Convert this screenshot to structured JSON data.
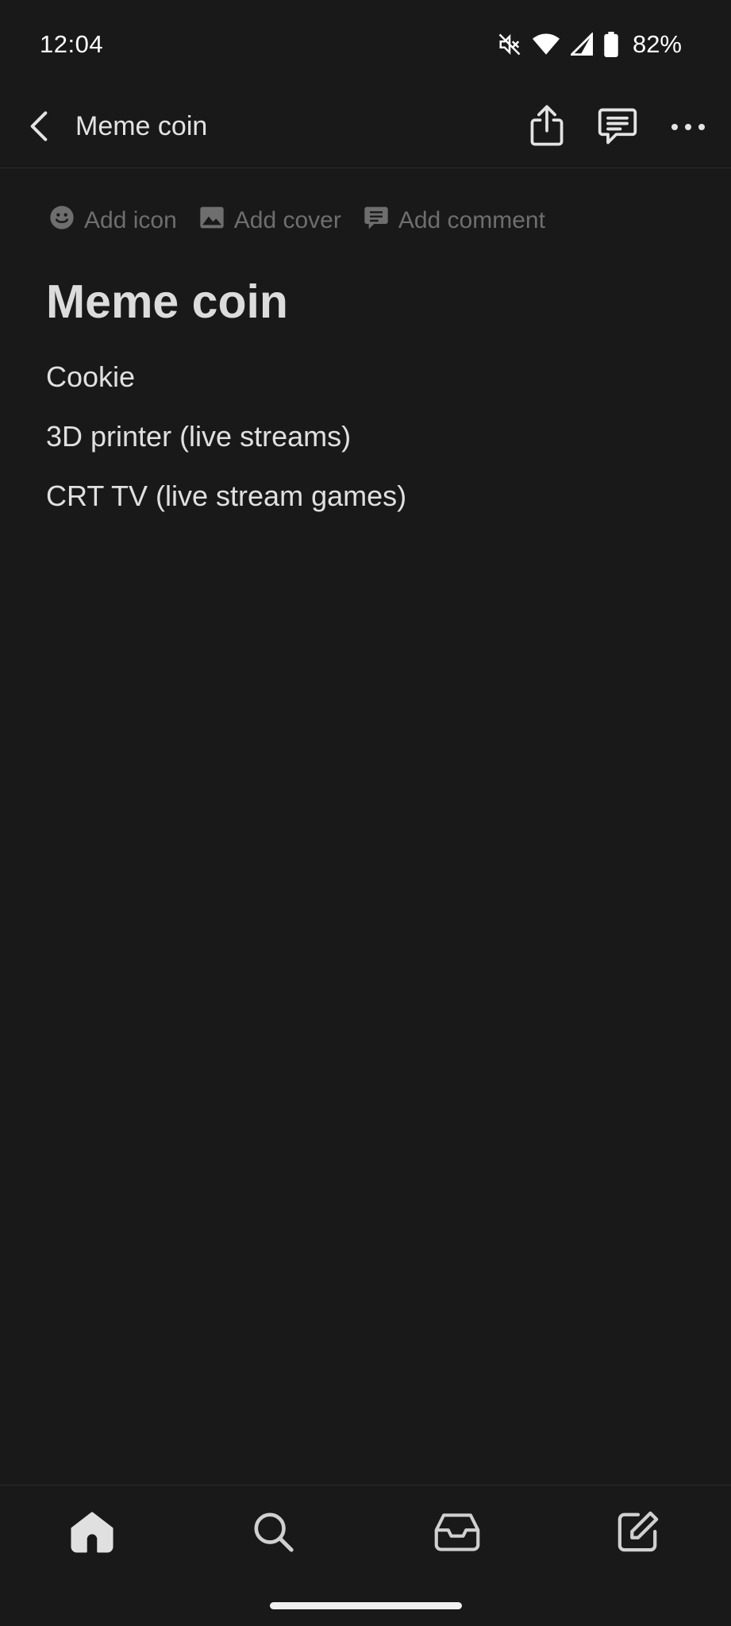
{
  "status_bar": {
    "time": "12:04",
    "battery_percent": "82%",
    "icons": [
      "mute-icon",
      "wifi-icon",
      "signal-icon",
      "battery-icon"
    ]
  },
  "top_bar": {
    "title": "Meme coin",
    "icons": [
      "back-icon",
      "share-icon",
      "comments-icon",
      "more-icon"
    ]
  },
  "page_actions": {
    "add_icon": "Add icon",
    "add_cover": "Add cover",
    "add_comment": "Add comment"
  },
  "document": {
    "title": "Meme coin",
    "blocks": [
      "Cookie",
      "3D printer (live streams)",
      "CRT TV (live stream games)"
    ]
  },
  "bottom_nav": {
    "icons": [
      "home-icon",
      "search-icon",
      "inbox-icon",
      "new-page-icon"
    ]
  },
  "colors": {
    "background": "#191919",
    "text": "#e6e6e6",
    "muted": "#6e6e6e"
  }
}
